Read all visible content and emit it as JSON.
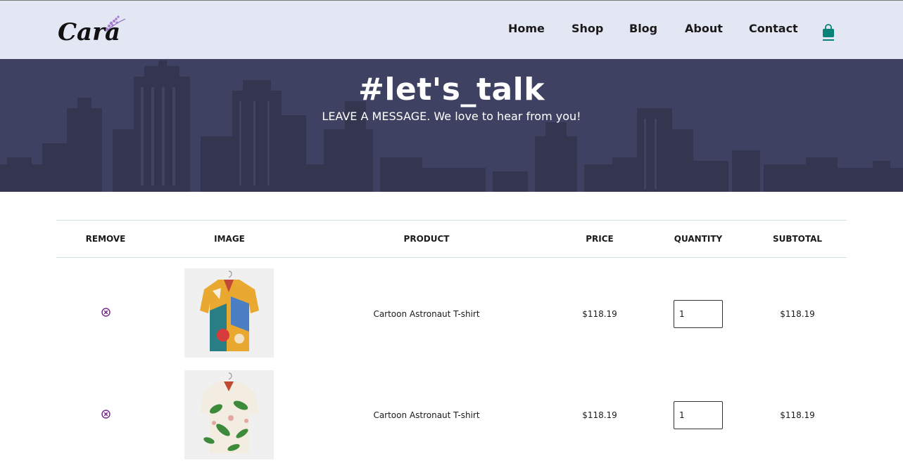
{
  "brand": {
    "logo_text": "Cara"
  },
  "nav": {
    "items": [
      "Home",
      "Shop",
      "Blog",
      "About",
      "Contact"
    ],
    "cart_icon": "shopping-bag-icon",
    "accent_color": "#088178"
  },
  "hero": {
    "title": "#let's_talk",
    "subtitle": "LEAVE A MESSAGE. We love to hear from you!"
  },
  "cart": {
    "headers": [
      "REMOVE",
      "IMAGE",
      "PRODUCT",
      "PRICE",
      "QUANTITY",
      "SUBTOTAL"
    ],
    "rows": [
      {
        "product": "Cartoon Astronaut T-shirt",
        "price": "$118.19",
        "quantity": "1",
        "subtotal": "$118.19",
        "image": "colorful-print-shirt"
      },
      {
        "product": "Cartoon Astronaut T-shirt",
        "price": "$118.19",
        "quantity": "1",
        "subtotal": "$118.19",
        "image": "floral-leaf-shirt"
      }
    ],
    "remove_icon": "remove-circle-icon",
    "remove_color": "#7b2c8f"
  }
}
